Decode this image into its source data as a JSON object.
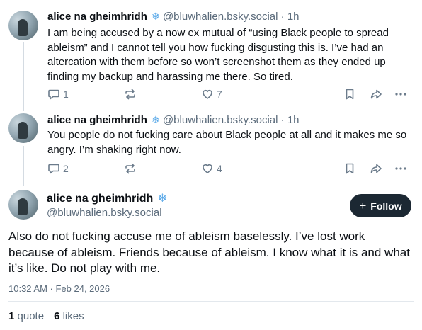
{
  "posts": [
    {
      "author": "alice na gheimhridh",
      "handle": "@bluwhalien.bsky.social",
      "separator": "·",
      "time": "1h",
      "text": "I am being accused by a now ex mutual of “using Black people to spread ableism” and I cannot tell you how fucking disgusting this is. I’ve had an altercation with them before so won’t screenshot them as they ended up finding my backup and harassing me there. So tired.",
      "replies": "1",
      "likes": "7"
    },
    {
      "author": "alice na gheimhridh",
      "handle": "@bluwhalien.bsky.social",
      "separator": "·",
      "time": "1h",
      "text": "You people do not fucking care about Black people at all and it makes me so angry. I’m shaking right now.",
      "replies": "2",
      "likes": "4"
    }
  ],
  "main_post": {
    "author": "alice na gheimhridh",
    "handle": "@bluwhalien.bsky.social",
    "follow_label": "Follow",
    "text": "Also do not fucking accuse me of ableism baselessly. I’ve lost work because of ableism. Friends because of ableism. I know what it is and what it’s like. Do not play with me.",
    "timestamp": "10:32 AM · Feb 24, 2026",
    "quotes_count": "1",
    "quotes_label": "quote",
    "likes_count": "6",
    "likes_label": "likes"
  },
  "icons": {
    "badge": "snowflake-icon",
    "reply": "reply-bubble-icon",
    "repost": "repost-icon",
    "like": "heart-icon",
    "bookmark": "bookmark-icon",
    "share": "share-arrow-icon",
    "more": "more-dots-icon",
    "follow": "plus-icon"
  },
  "colors": {
    "badge": "#56a7e8",
    "follow_button": "#1c2833",
    "secondary_text": "#5b6b7b",
    "thread_line": "#d4dbe2"
  }
}
